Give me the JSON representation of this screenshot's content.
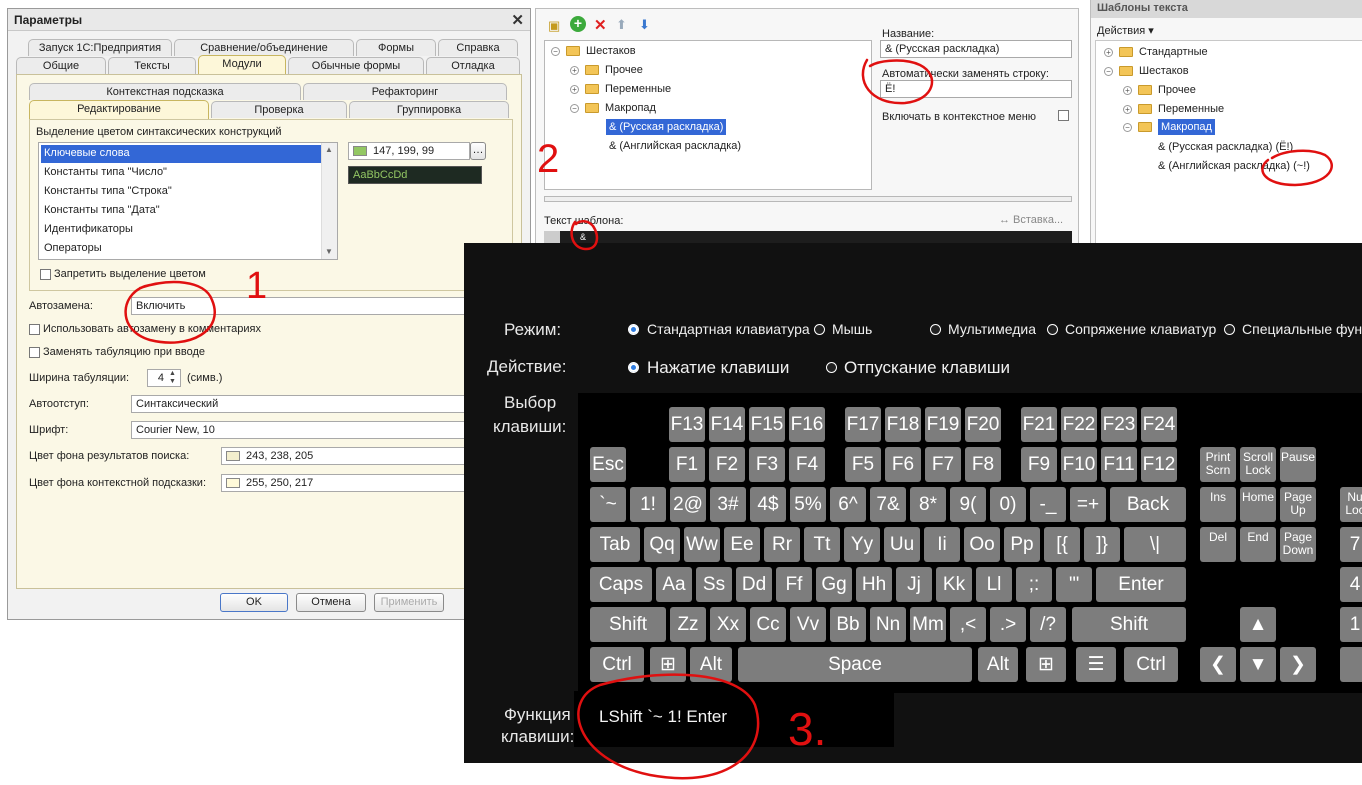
{
  "params_window": {
    "title": "Параметры",
    "tabs_row1": [
      "Запуск 1С:Предприятия",
      "Сравнение/объединение",
      "Формы",
      "Справка"
    ],
    "tabs_row2": [
      "Общие",
      "Тексты",
      "Модули",
      "Обычные формы",
      "Отладка"
    ],
    "active_tab": "Модули",
    "subtabs_row1": [
      "Контекстная подсказка",
      "Рефакторинг"
    ],
    "subtabs_row2": [
      "Редактирование",
      "Проверка",
      "Группировка"
    ],
    "active_subtab": "Редактирование",
    "syntax_group_label": "Выделение цветом синтаксических конструкций",
    "syntax_items": [
      "Ключевые слова",
      "Константы типа \"Число\"",
      "Константы типа \"Строка\"",
      "Константы типа \"Дата\"",
      "Идентификаторы",
      "Операторы"
    ],
    "selected_syntax": "Ключевые слова",
    "color_value": "147, 199, 99",
    "color_hex": "#93c763",
    "preview_text": "AaBbCcDd",
    "disable_highlight_label": "Запретить выделение цветом",
    "autoreplace_label": "Автозамена:",
    "autoreplace_value": "Включить",
    "use_in_comments_label": "Использовать автозамену в комментариях",
    "replace_tab_label": "Заменять табуляцию при вводе",
    "tab_width_label": "Ширина табуляции:",
    "tab_width_value": "4",
    "tab_width_unit": "(симв.)",
    "autoindent_label": "Автоотступ:",
    "autoindent_value": "Синтаксический",
    "font_label": "Шрифт:",
    "font_value": "Courier New, 10",
    "search_bg_label": "Цвет фона результатов поиска:",
    "search_bg_value": "243, 238, 205",
    "search_bg_hex": "#f3eecd",
    "hint_bg_label": "Цвет фона контекстной подсказки:",
    "hint_bg_value": "255, 250, 217",
    "hint_bg_hex": "#fffad9",
    "ok": "OK",
    "cancel": "Отмена",
    "apply": "Применить"
  },
  "template_editor": {
    "tree": [
      "Шестаков",
      "Прочее",
      "Переменные",
      "Макропад",
      "& (Русская раскладка)",
      "& (Английская раскладка)"
    ],
    "selected": "& (Русская раскладка)",
    "name_label": "Название:",
    "name_value": "& (Русская раскладка)",
    "autoreplace_label": "Автоматически заменять строку:",
    "autoreplace_value": "Ё!",
    "context_menu_label": "Включать в контекстное меню",
    "template_text_label": "Текст шаблона:",
    "insert_label": "↔ Вставка...",
    "template_text": "&"
  },
  "templates_panel": {
    "title": "Шаблоны текста",
    "actions": "Действия ▾",
    "tree": [
      "Стандартные",
      "Шестаков",
      "Прочее",
      "Переменные",
      "Макропад",
      "& (Русская раскладка) (Ё!)",
      "& (Английская раскладка) (~!)"
    ],
    "selected": "Макропад"
  },
  "keyboard_app": {
    "mode_label": "Режим:",
    "modes": [
      "Стандартная клавиатура",
      "Мышь",
      "Мультимедиа",
      "Сопряжение клавиатур",
      "Специальные функ"
    ],
    "selected_mode": "Стандартная клавиатура",
    "action_label": "Действие:",
    "actions": [
      "Нажатие клавиши",
      "Отпускание клавиши"
    ],
    "selected_action": "Нажатие клавиши",
    "key_select_label_1": "Выбор",
    "key_select_label_2": "клавиши:",
    "func_label_1": "Функция",
    "func_label_2": "клавиши:",
    "func_value": "LShift `~ 1! Enter"
  },
  "annotations": [
    "1",
    "1",
    "2",
    "3."
  ],
  "annotation_color": "#e01010"
}
